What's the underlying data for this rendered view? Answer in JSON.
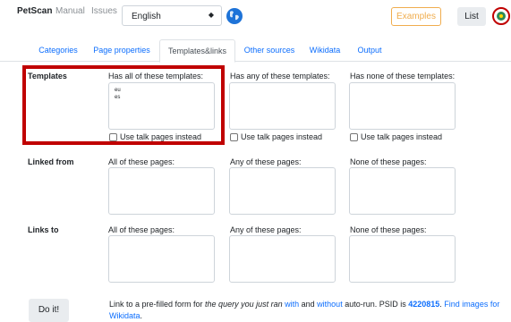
{
  "navbar": {
    "brand": "PetScan",
    "manual": "Manual",
    "issues": "Issues",
    "language": "English",
    "examples": "Examples",
    "list": "List"
  },
  "tabs": [
    {
      "label": "Categories"
    },
    {
      "label": "Page properties"
    },
    {
      "label": "Templates&links"
    },
    {
      "label": "Other sources"
    },
    {
      "label": "Wikidata"
    },
    {
      "label": "Output"
    }
  ],
  "templates": {
    "label": "Templates",
    "all_label": "Has all of these templates:",
    "any_label": "Has any of these templates:",
    "none_label": "Has none of these templates:",
    "all_values": [
      "eu",
      "es"
    ],
    "talk_label": "Use talk pages instead"
  },
  "linked_from": {
    "label": "Linked from",
    "all_label": "All of these pages:",
    "any_label": "Any of these pages:",
    "none_label": "None of these pages:"
  },
  "links_to": {
    "label": "Links to",
    "all_label": "All of these pages:",
    "any_label": "Any of these pages:",
    "none_label": "None of these pages:"
  },
  "footer": {
    "do_it": "Do it!",
    "text_1": "Link to a pre-filled form for ",
    "text_italic": "the query you just ran",
    "with": "with",
    "text_and": " and ",
    "without": "without",
    "text_2": " auto-run. PSID is ",
    "psid": "4220815",
    "text_3": ". ",
    "find_images": "Find images for Wikidata",
    "text_4": "."
  }
}
